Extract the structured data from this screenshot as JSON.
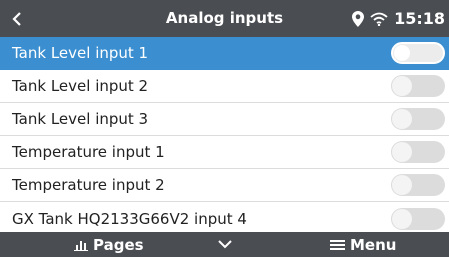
{
  "header": {
    "title": "Analog inputs",
    "time": "15:18",
    "icons": [
      "back-icon",
      "location-pin-icon",
      "wifi-icon"
    ]
  },
  "inputs": [
    {
      "label": "Tank Level input 1",
      "enabled": false,
      "selected": true
    },
    {
      "label": "Tank Level input 2",
      "enabled": false,
      "selected": false
    },
    {
      "label": "Tank Level input 3",
      "enabled": false,
      "selected": false
    },
    {
      "label": "Temperature input 1",
      "enabled": false,
      "selected": false
    },
    {
      "label": "Temperature input 2",
      "enabled": false,
      "selected": false
    },
    {
      "label": "GX Tank HQ2133G66V2 input 4",
      "enabled": false,
      "selected": false
    }
  ],
  "footer": {
    "pages_label": "Pages",
    "menu_label": "Menu",
    "icons": [
      "bar-chart-icon",
      "chevron-down-icon",
      "hamburger-menu-icon"
    ]
  },
  "colors": {
    "bar": "#4a4d52",
    "selected_row": "#3b8fd0",
    "toggle_off": "#dcdcdc"
  }
}
